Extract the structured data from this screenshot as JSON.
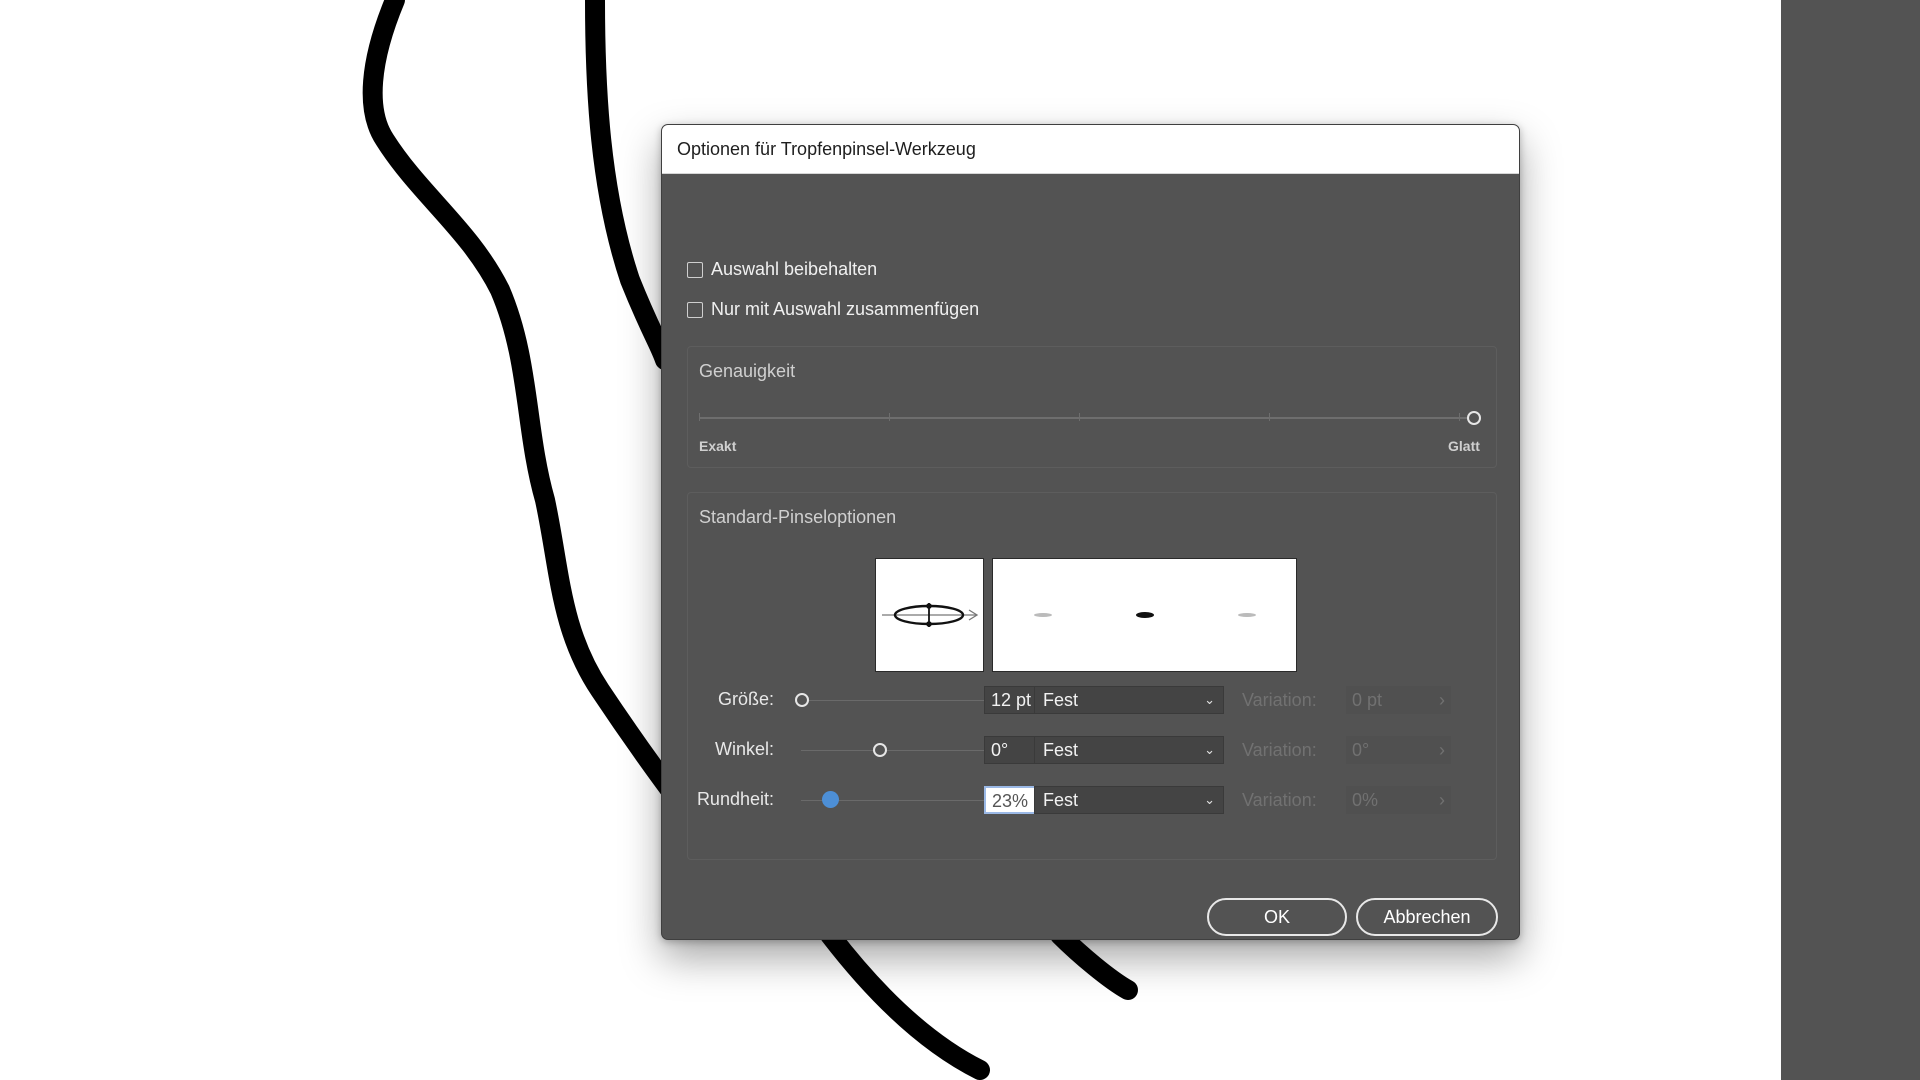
{
  "dialog": {
    "title": "Optionen für Tropfenpinsel-Werkzeug",
    "checkbox_keep_selection": "Auswahl beibehalten",
    "checkbox_merge_selection": "Nur mit Auswahl zusammenfügen",
    "accuracy": {
      "title": "Genauigkeit",
      "min_label": "Exakt",
      "max_label": "Glatt",
      "value_fraction": 1.0
    },
    "brush": {
      "title": "Standard-Pinseloptionen",
      "rows": [
        {
          "label": "Größe:",
          "value": "12 pt",
          "mode": "Fest",
          "variation_label": "Variation:",
          "variation_value": "0 pt",
          "slider_fraction": 0.0
        },
        {
          "label": "Winkel:",
          "value": "0°",
          "mode": "Fest",
          "variation_label": "Variation:",
          "variation_value": "0°",
          "slider_fraction": 0.5
        },
        {
          "label": "Rundheit:",
          "value": "23%",
          "mode": "Fest",
          "variation_label": "Variation:",
          "variation_value": "0%",
          "slider_fraction": 0.23
        }
      ]
    },
    "ok_label": "OK",
    "cancel_label": "Abbrechen"
  },
  "colors": {
    "dialog_bg": "#535353",
    "accent": "#4d8fd6",
    "canvas": "#ffffff",
    "stroke": "#000000"
  }
}
